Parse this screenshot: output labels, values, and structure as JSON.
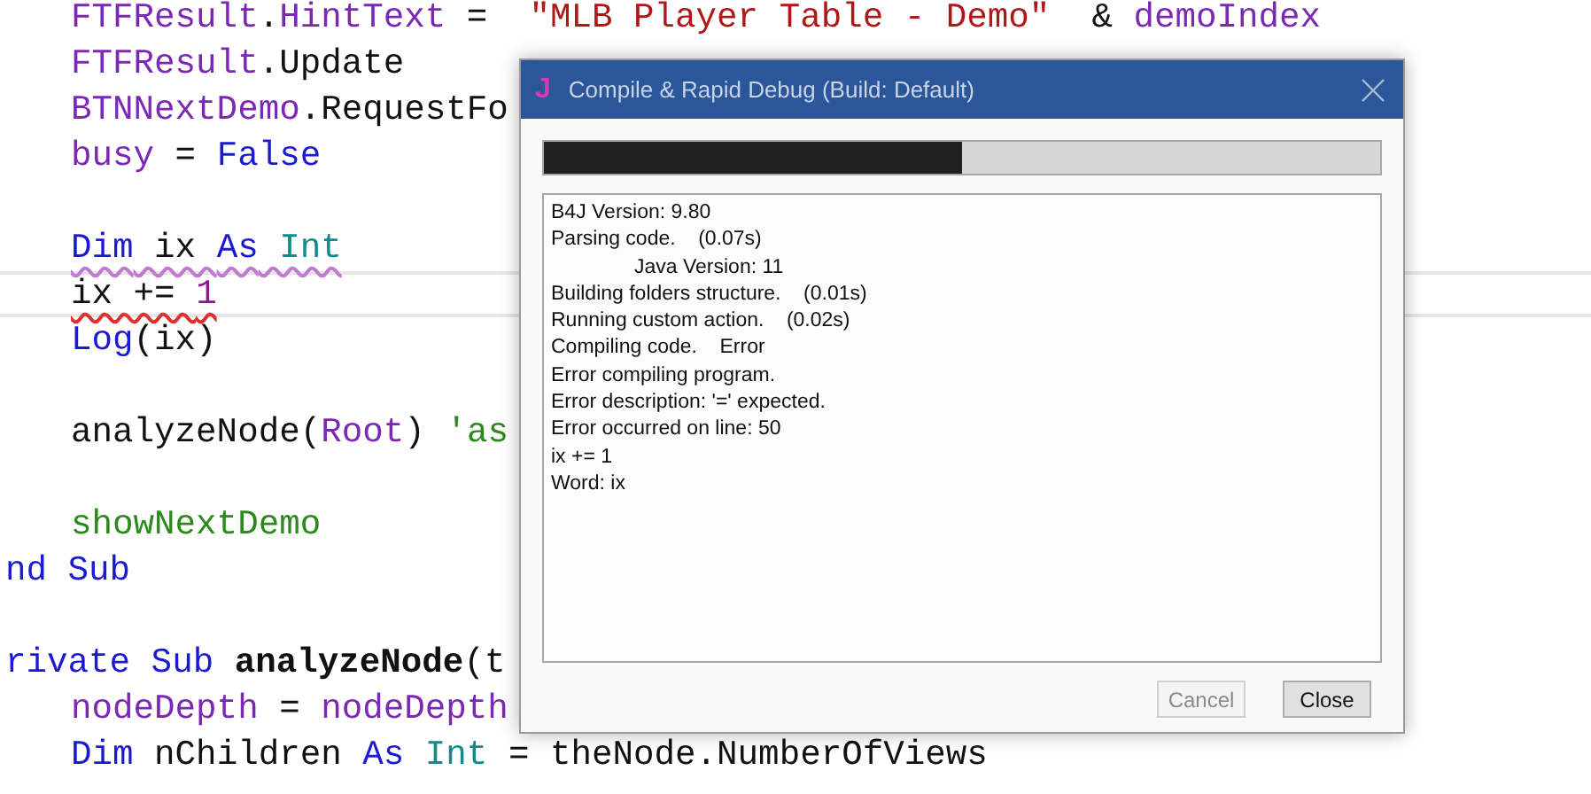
{
  "editor": {
    "lines": [
      {
        "kind": "code",
        "indented": true,
        "tokens": [
          {
            "kind": "ident",
            "text": "FTFResult"
          },
          {
            "kind": "plain",
            "text": "."
          },
          {
            "kind": "ident",
            "text": "HintText"
          },
          {
            "kind": "plain",
            "text": " =  "
          },
          {
            "kind": "string",
            "text": "\"MLB Player Table - Demo\""
          },
          {
            "kind": "plain",
            "text": "  & "
          },
          {
            "kind": "ident",
            "text": "demoIndex"
          }
        ]
      },
      {
        "kind": "code",
        "indented": true,
        "tokens": [
          {
            "kind": "ident",
            "text": "FTFResult"
          },
          {
            "kind": "plain",
            "text": ".Update"
          }
        ]
      },
      {
        "kind": "code",
        "indented": true,
        "tokens": [
          {
            "kind": "ident",
            "text": "BTNNextDemo"
          },
          {
            "kind": "plain",
            "text": ".RequestFo"
          }
        ]
      },
      {
        "kind": "code",
        "indented": true,
        "tokens": [
          {
            "kind": "ident",
            "text": "busy"
          },
          {
            "kind": "plain",
            "text": " = "
          },
          {
            "kind": "keyword",
            "text": "False"
          }
        ]
      },
      {
        "kind": "blank"
      },
      {
        "kind": "code",
        "indented": true,
        "color": "#c07ad0",
        "tokens": [
          {
            "kind": "keyword",
            "text": "Dim"
          },
          {
            "kind": "plain",
            "text": " ix "
          },
          {
            "kind": "keyword",
            "text": "As"
          },
          {
            "kind": "type",
            "text": " Int"
          }
        ]
      },
      {
        "kind": "code",
        "indented": true,
        "current": true,
        "color": "#e03030",
        "tokens": [
          {
            "kind": "plain",
            "text": "ix += "
          },
          {
            "kind": "number",
            "text": "1"
          }
        ]
      },
      {
        "kind": "code",
        "indented": true,
        "tokens": [
          {
            "kind": "keyword",
            "text": "Log"
          },
          {
            "kind": "plain",
            "text": "(ix)"
          }
        ]
      },
      {
        "kind": "blank"
      },
      {
        "kind": "code",
        "indented": true,
        "tokens": [
          {
            "kind": "plain",
            "text": "analyzeNode("
          },
          {
            "kind": "ident",
            "text": "Root"
          },
          {
            "kind": "plain",
            "text": ") "
          },
          {
            "kind": "comment",
            "text": "'as"
          }
        ]
      },
      {
        "kind": "blank"
      },
      {
        "kind": "code",
        "indented": true,
        "tokens": [
          {
            "kind": "comment",
            "text": "showNextDemo"
          }
        ]
      },
      {
        "kind": "code",
        "indented": false,
        "tokens": [
          {
            "kind": "keyword",
            "text": "nd Sub"
          }
        ]
      },
      {
        "kind": "blank"
      },
      {
        "kind": "code",
        "indented": false,
        "tokens": [
          {
            "kind": "keyword",
            "text": "rivate Sub "
          },
          {
            "kind": "bold",
            "text": "analyzeNode"
          },
          {
            "kind": "plain",
            "text": "(t"
          }
        ]
      },
      {
        "kind": "code",
        "indented": true,
        "tokens": [
          {
            "kind": "ident",
            "text": "nodeDepth"
          },
          {
            "kind": "plain",
            "text": " = "
          },
          {
            "kind": "ident",
            "text": "nodeDepth"
          }
        ]
      },
      {
        "kind": "code",
        "indented": true,
        "tokens": [
          {
            "kind": "keyword",
            "text": "Dim"
          },
          {
            "kind": "plain",
            "text": " nChildren "
          },
          {
            "kind": "keyword",
            "text": "As"
          },
          {
            "kind": "type",
            "text": " Int"
          },
          {
            "kind": "plain",
            "text": " = theNode.NumberOfViews"
          }
        ]
      }
    ]
  },
  "dialog": {
    "icon": "J",
    "title": "Compile & Rapid Debug (Build: Default)",
    "progress": {
      "level": 0.5
    },
    "log": [
      {
        "text": "B4J Version: 9.80",
        "indented": false
      },
      {
        "text": "Parsing code.    (0.07s)",
        "indented": false
      },
      {
        "text": "Java Version: 11",
        "indented": true
      },
      {
        "text": "Building folders structure.    (0.01s)",
        "indented": false
      },
      {
        "text": "Running custom action.    (0.02s)",
        "indented": false
      },
      {
        "text": "Compiling code.    Error",
        "indented": false
      },
      {
        "text": "Error compiling program.",
        "indented": false
      },
      {
        "text": "Error description: '=' expected.",
        "indented": false
      },
      {
        "text": "Error occurred on line: 50",
        "indented": false
      },
      {
        "text": "ix += 1",
        "indented": false
      },
      {
        "text": "Word: ix",
        "indented": false
      }
    ],
    "buttons": [
      {
        "label": "Cancel",
        "disabled": true
      },
      {
        "label": "Close",
        "disabled": false
      }
    ]
  }
}
